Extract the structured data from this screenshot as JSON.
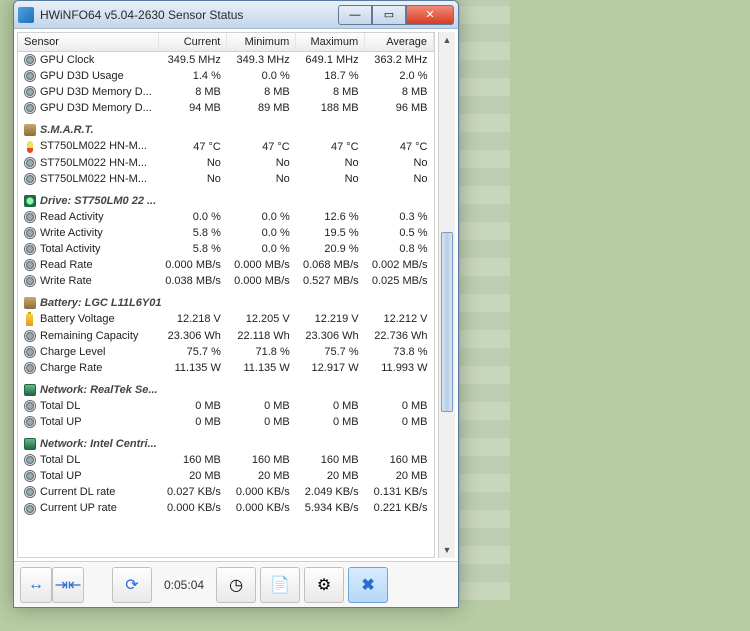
{
  "window": {
    "title": "HWiNFO64 v5.04-2630 Sensor Status"
  },
  "columns": [
    "Sensor",
    "Current",
    "Minimum",
    "Maximum",
    "Average"
  ],
  "groups": [
    {
      "name": "",
      "rows": [
        {
          "icon": "gear",
          "label": "GPU Clock",
          "cur": "349.5 MHz",
          "min": "349.3 MHz",
          "max": "649.1 MHz",
          "avg": "363.2 MHz"
        },
        {
          "icon": "gear",
          "label": "GPU D3D Usage",
          "cur": "1.4 %",
          "min": "0.0 %",
          "max": "18.7 %",
          "avg": "2.0 %"
        },
        {
          "icon": "gear",
          "label": "GPU D3D Memory D...",
          "cur": "8 MB",
          "min": "8 MB",
          "max": "8 MB",
          "avg": "8 MB"
        },
        {
          "icon": "gear",
          "label": "GPU D3D Memory D...",
          "cur": "94 MB",
          "min": "89 MB",
          "max": "188 MB",
          "avg": "96 MB"
        }
      ]
    },
    {
      "name": "S.M.A.R.T.",
      "icon": "disk",
      "rows": [
        {
          "icon": "therm",
          "label": "ST750LM022 HN-M...",
          "cur": "47 °C",
          "min": "47 °C",
          "max": "47 °C",
          "avg": "47 °C"
        },
        {
          "icon": "gear",
          "label": "ST750LM022 HN-M...",
          "cur": "No",
          "min": "No",
          "max": "No",
          "avg": "No"
        },
        {
          "icon": "gear",
          "label": "ST750LM022 HN-M...",
          "cur": "No",
          "min": "No",
          "max": "No",
          "avg": "No"
        }
      ]
    },
    {
      "name": "Drive: ST750LM0 22 ...",
      "icon": "gdisk",
      "rows": [
        {
          "icon": "gear",
          "label": "Read Activity",
          "cur": "0.0 %",
          "min": "0.0 %",
          "max": "12.6 %",
          "avg": "0.3 %"
        },
        {
          "icon": "gear",
          "label": "Write Activity",
          "cur": "5.8 %",
          "min": "0.0 %",
          "max": "19.5 %",
          "avg": "0.5 %"
        },
        {
          "icon": "gear",
          "label": "Total Activity",
          "cur": "5.8 %",
          "min": "0.0 %",
          "max": "20.9 %",
          "avg": "0.8 %"
        },
        {
          "icon": "gear",
          "label": "Read Rate",
          "cur": "0.000 MB/s",
          "min": "0.000 MB/s",
          "max": "0.068 MB/s",
          "avg": "0.002 MB/s"
        },
        {
          "icon": "gear",
          "label": "Write Rate",
          "cur": "0.038 MB/s",
          "min": "0.000 MB/s",
          "max": "0.527 MB/s",
          "avg": "0.025 MB/s"
        }
      ]
    },
    {
      "name": "Battery: LGC L11L6Y01",
      "icon": "disk",
      "rows": [
        {
          "icon": "batt",
          "label": "Battery Voltage",
          "cur": "12.218 V",
          "min": "12.205 V",
          "max": "12.219 V",
          "avg": "12.212 V"
        },
        {
          "icon": "gear",
          "label": "Remaining Capacity",
          "cur": "23.306 Wh",
          "min": "22.118 Wh",
          "max": "23.306 Wh",
          "avg": "22.736 Wh"
        },
        {
          "icon": "gear",
          "label": "Charge Level",
          "cur": "75.7 %",
          "min": "71.8 %",
          "max": "75.7 %",
          "avg": "73.8 %"
        },
        {
          "icon": "gear",
          "label": "Charge Rate",
          "cur": "11.135 W",
          "min": "11.135 W",
          "max": "12.917 W",
          "avg": "11.993 W"
        }
      ]
    },
    {
      "name": "Network: RealTek Se...",
      "icon": "net",
      "rows": [
        {
          "icon": "gear",
          "label": "Total DL",
          "cur": "0 MB",
          "min": "0 MB",
          "max": "0 MB",
          "avg": "0 MB"
        },
        {
          "icon": "gear",
          "label": "Total UP",
          "cur": "0 MB",
          "min": "0 MB",
          "max": "0 MB",
          "avg": "0 MB"
        }
      ]
    },
    {
      "name": "Network: Intel Centri...",
      "icon": "net",
      "rows": [
        {
          "icon": "gear",
          "label": "Total DL",
          "cur": "160 MB",
          "min": "160 MB",
          "max": "160 MB",
          "avg": "160 MB"
        },
        {
          "icon": "gear",
          "label": "Total UP",
          "cur": "20 MB",
          "min": "20 MB",
          "max": "20 MB",
          "avg": "20 MB"
        },
        {
          "icon": "gear",
          "label": "Current DL rate",
          "cur": "0.027 KB/s",
          "min": "0.000 KB/s",
          "max": "2.049 KB/s",
          "avg": "0.131 KB/s"
        },
        {
          "icon": "gear",
          "label": "Current UP rate",
          "cur": "0.000 KB/s",
          "min": "0.000 KB/s",
          "max": "5.934 KB/s",
          "avg": "0.221 KB/s"
        }
      ]
    }
  ],
  "toolbar": {
    "time": "0:05:04"
  }
}
